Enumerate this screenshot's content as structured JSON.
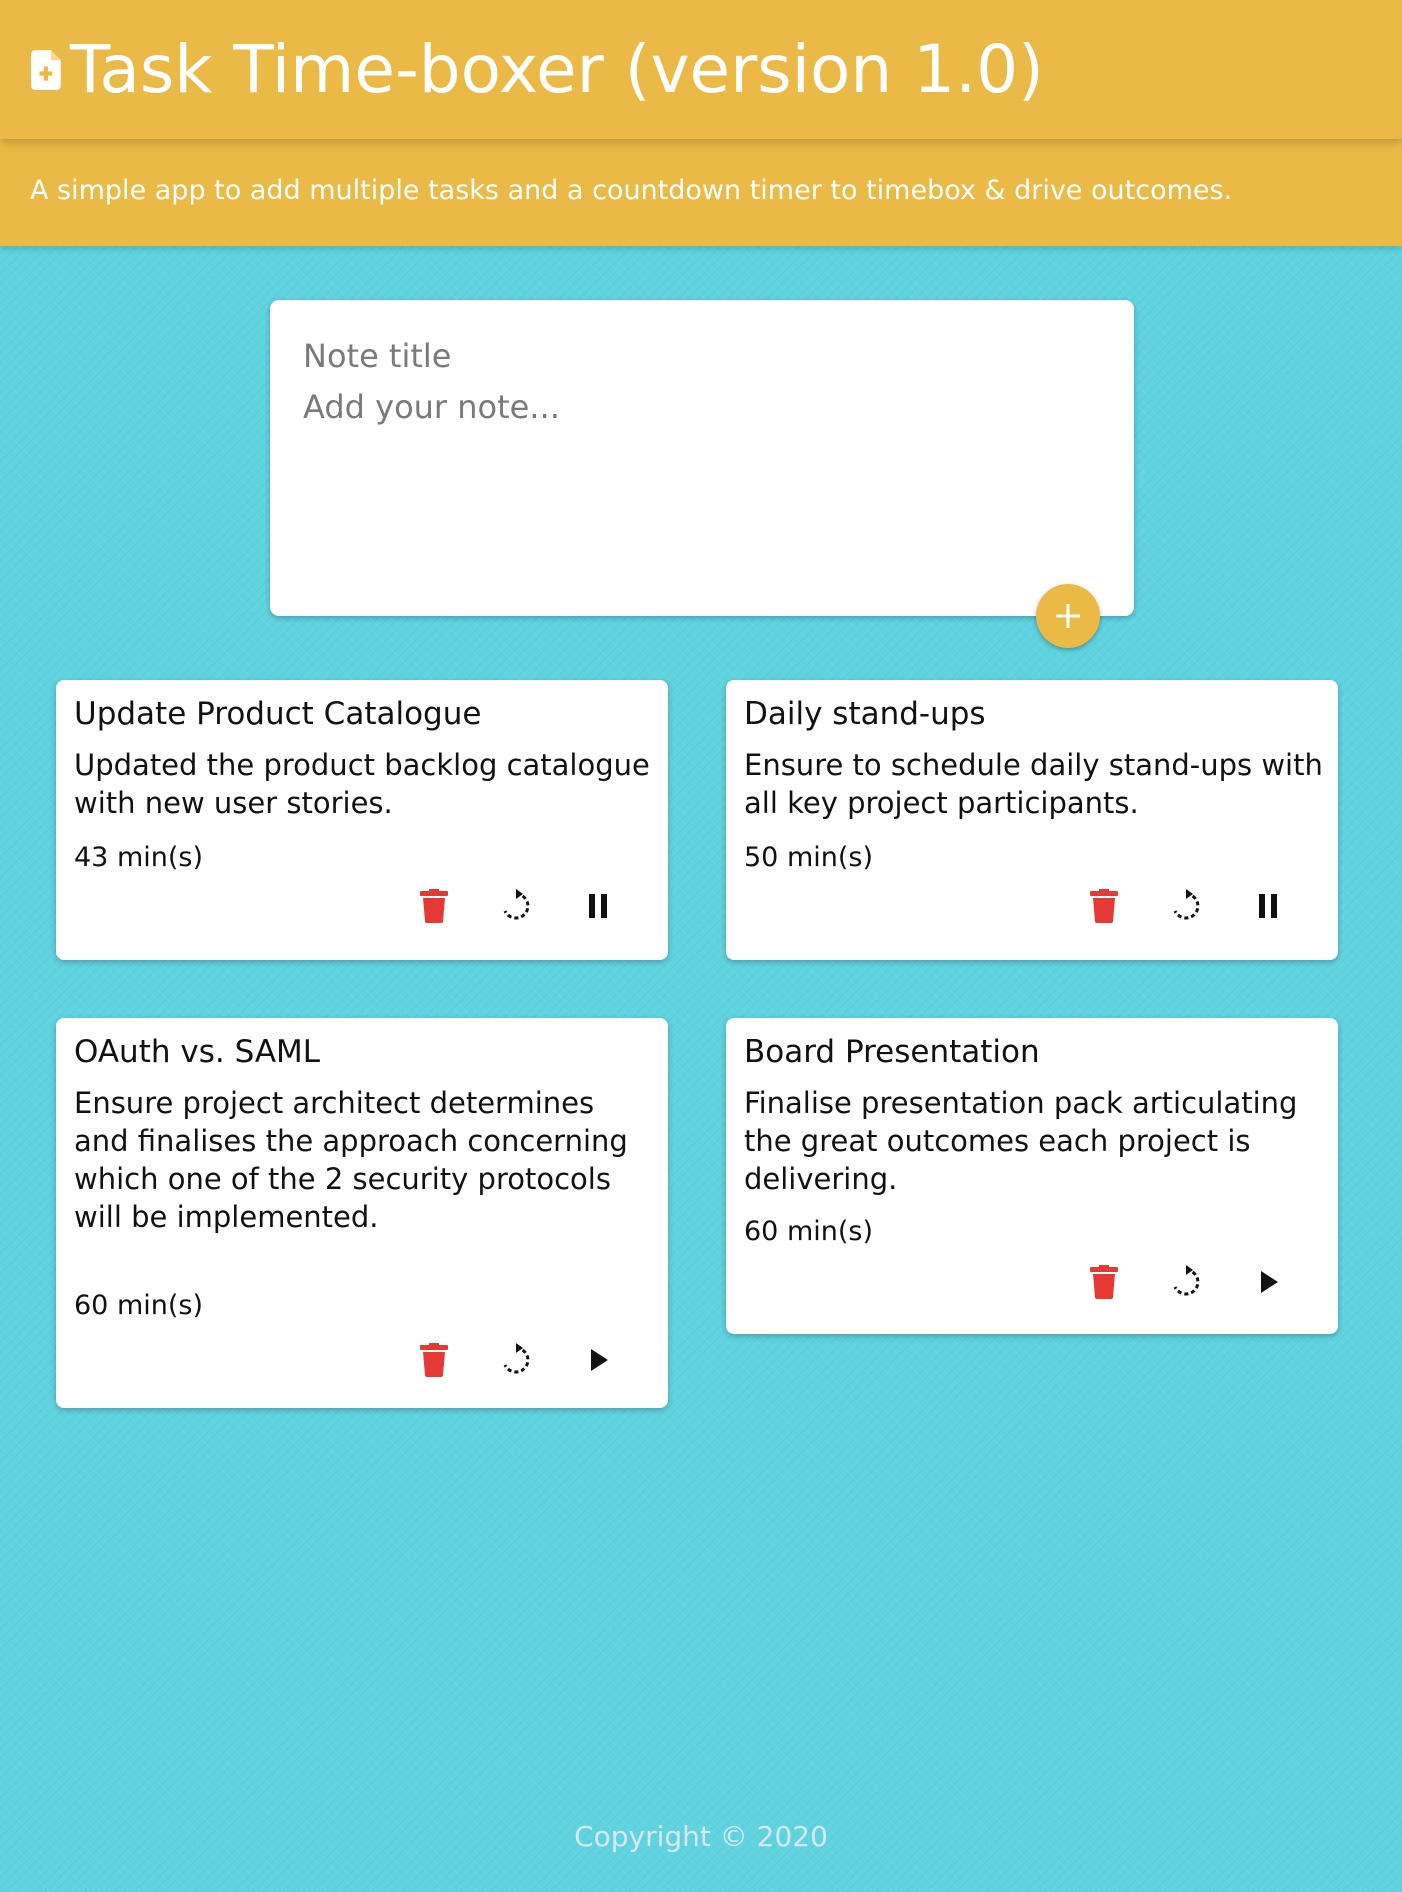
{
  "header": {
    "title": "Task Time-boxer (version 1.0)",
    "icon": "note-add-icon",
    "subtitle": "A simple app to add multiple tasks and a countdown timer to timebox & drive outcomes."
  },
  "create_note": {
    "title_placeholder": "Note title",
    "content_placeholder": "Add your note...",
    "add_button_icon": "plus-icon"
  },
  "notes": [
    {
      "title": "Update Product Catalogue",
      "content": "Updated the product backlog catalogue with new user stories.",
      "timer": "43 min(s)",
      "state": "running",
      "actions": [
        "delete-icon",
        "restart-icon",
        "pause-icon"
      ]
    },
    {
      "title": "Daily stand-ups",
      "content": "Ensure to schedule daily stand-ups with all key project participants.",
      "timer": "50 min(s)",
      "state": "running",
      "actions": [
        "delete-icon",
        "restart-icon",
        "pause-icon"
      ]
    },
    {
      "title": "OAuth vs. SAML",
      "content": "Ensure project architect determines and finalises the approach concerning which one of the 2 security protocols will be implemented.",
      "timer": "60 min(s)",
      "state": "stopped",
      "actions": [
        "delete-icon",
        "restart-icon",
        "play-icon"
      ]
    },
    {
      "title": "Board Presentation",
      "content": "Finalise presentation pack articulating the great outcomes each project is delivering.",
      "timer": "60 min(s)",
      "state": "stopped",
      "actions": [
        "delete-icon",
        "restart-icon",
        "play-icon"
      ]
    }
  ],
  "footer": {
    "copyright": "Copyright © 2020"
  },
  "colors": {
    "header_bg": "#ebba46",
    "page_bg": "#5fd3e0",
    "delete_red": "#e53935",
    "card_bg": "#ffffff"
  }
}
